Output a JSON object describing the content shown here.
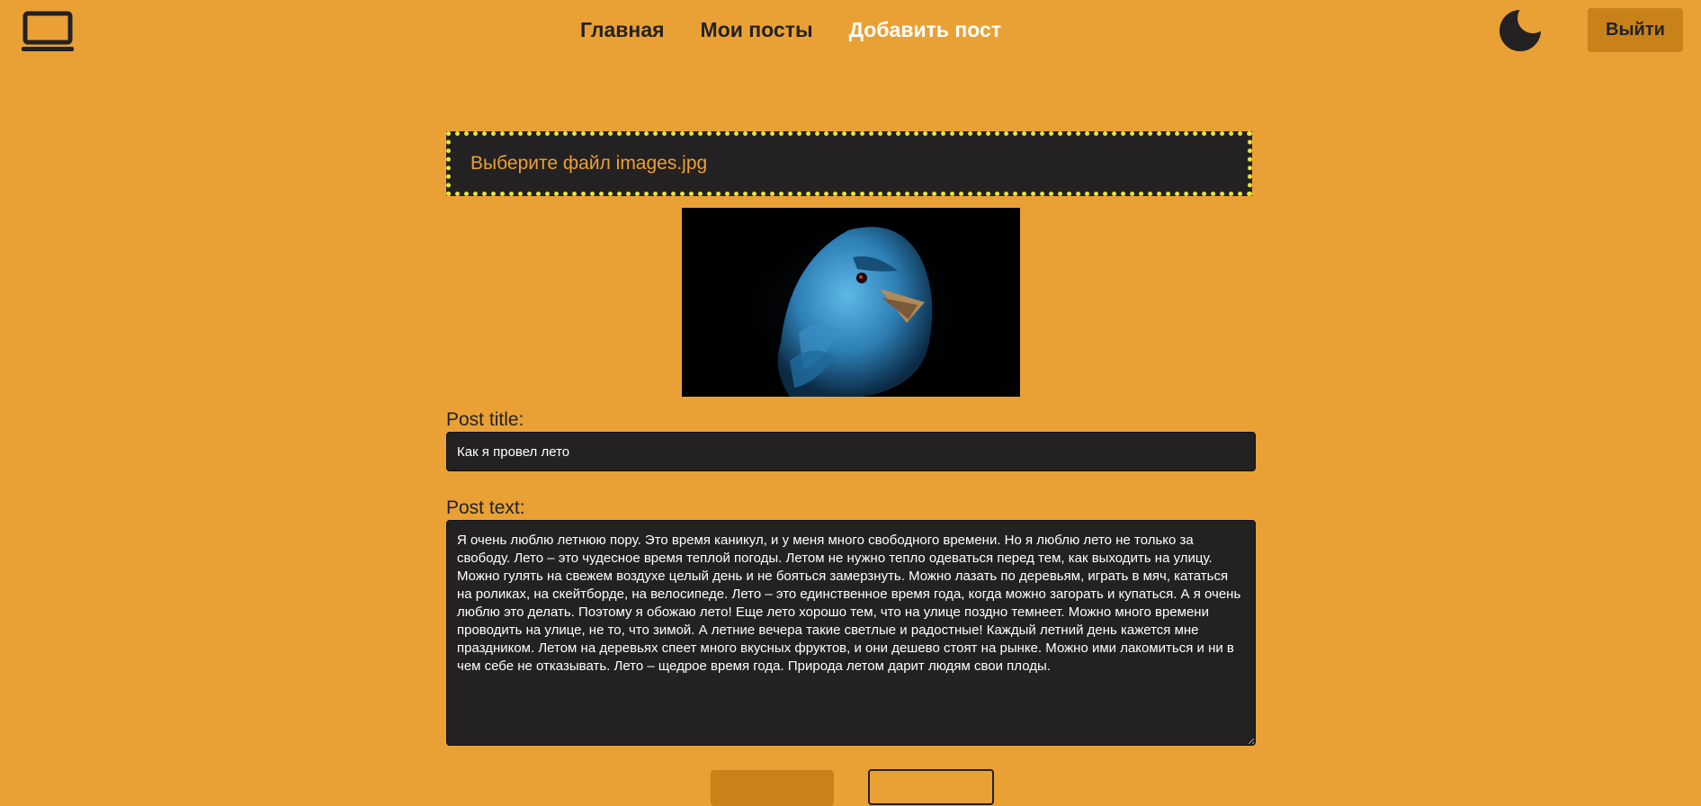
{
  "nav": {
    "items": [
      {
        "label": "Главная",
        "active": false
      },
      {
        "label": "Мои посты",
        "active": false
      },
      {
        "label": "Добавить пост",
        "active": true
      }
    ]
  },
  "header": {
    "logo_icon": "laptop-icon",
    "theme_icon": "moon-icon",
    "logout_label": "Выйти"
  },
  "form": {
    "file_label": "Выберите файл images.jpg",
    "preview_icon": "blue-bird-image",
    "title_label": "Post title:",
    "title_value": "Как я провел лето",
    "text_label": "Post text:",
    "text_value": "Я очень люблю летнюю пору. Это время каникул, и у меня много свободного времени. Но я люблю лето не только за свободу. Лето – это чудесное время теплой погоды. Летом не нужно тепло одеваться перед тем, как выходить на улицу. Можно гулять на свежем воздухе целый день и не бояться замерзнуть. Можно лазать по деревьям, играть в мяч, кататься на роликах, на скейтборде, на велосипеде. Лето – это единственное время года, когда можно загорать и купаться. А я очень люблю это делать. Поэтому я обожаю лето! Еще лето хорошо тем, что на улице поздно темнеет. Можно много времени проводить на улице, не то, что зимой. А летние вечера такие светлые и радостные! Каждый летний день кажется мне праздником. Летом на деревьях спеет много вкусных фруктов, и они дешево стоят на рынке. Можно ими лакомиться и ни в чем себе не отказывать. Лето – щедрое время года. Природа летом дарит людям свои плоды."
  },
  "colors": {
    "background": "#e9a135",
    "dark": "#242122",
    "active_nav": "#ffffff",
    "button": "#c9821a",
    "dotted_border": "#e8e33a"
  }
}
